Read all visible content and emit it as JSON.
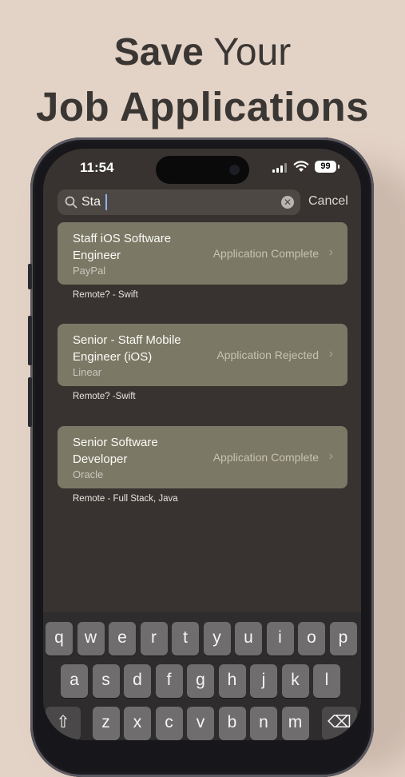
{
  "headline": {
    "line1_bold": "Save",
    "line1_rest": " Your",
    "line2": "Job Applications"
  },
  "status_bar": {
    "time": "11:54",
    "battery": "99"
  },
  "search": {
    "value": "Sta",
    "cancel_label": "Cancel"
  },
  "results": [
    {
      "title": "Staff iOS Software Engineer",
      "company": "PayPal",
      "status": "Application Complete",
      "note": "Remote? - Swift"
    },
    {
      "title": "Senior - Staff Mobile Engineer (iOS)",
      "company": "Linear",
      "status": "Application Rejected",
      "note": "Remote? -Swift"
    },
    {
      "title": "Senior Software Developer",
      "company": "Oracle",
      "status": "Application Complete",
      "note": "Remote - Full Stack, Java"
    }
  ],
  "keyboard": {
    "row1": [
      "q",
      "w",
      "e",
      "r",
      "t",
      "y",
      "u",
      "i",
      "o",
      "p"
    ],
    "row2": [
      "a",
      "s",
      "d",
      "f",
      "g",
      "h",
      "j",
      "k",
      "l"
    ],
    "row3": [
      "z",
      "x",
      "c",
      "v",
      "b",
      "n",
      "m"
    ]
  },
  "colors": {
    "background": "#e3d2c6",
    "card": "#7b7865",
    "screen": "#383330"
  }
}
